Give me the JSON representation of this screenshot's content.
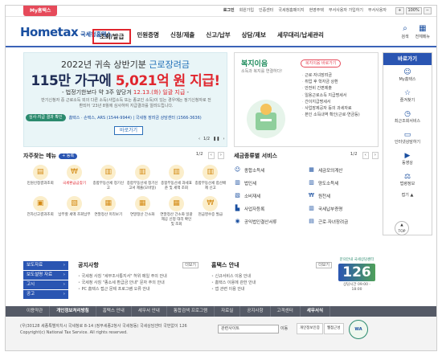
{
  "topbar": {
    "my_tab": "My홈택스",
    "utils": [
      "로그인",
      "회원가입",
      "인증센터",
      "국세청홈페이지",
      "현영주택",
      "부서사용자 가입하기",
      "부서사용자"
    ],
    "zoom_value": "100%"
  },
  "header": {
    "logo_main": "Hometax",
    "logo_sub": "국세청홈택스",
    "gnb": [
      "조회/발급",
      "민원증명",
      "신청/제출",
      "신고/납부",
      "상담/제보",
      "세무대리/납세관리"
    ],
    "search_label": "검색",
    "allmenu_label": "전체메뉴"
  },
  "banner": {
    "line1_a": "2022년 귀속 상반기분",
    "line1_b": "근로장려금",
    "line2_a": "115만 가구에",
    "line2_b": "5,021억 원 지급!",
    "line3_a": "- 법정기한보다 약 3주 앞당겨",
    "line3_b": "12.13.(화) 일괄 지급",
    "line3_c": "-",
    "desc": "반기신청자 중 근로소득 외의 다른 소득(사업소득 또는 종교인 소득)이 있는 경우에는 정기신청자로 전환되어 '23년 8월에 심사하여 지급결과를 알려드립니다.",
    "pill": "심사·지급 결과 확인",
    "strip_text": "홈택스 · 손택스, ARS (1544-9944) | 국세청 장려금 상담센터 (1566-3636)",
    "more_label": "바로가기",
    "counter": "1/2"
  },
  "welfare": {
    "title": "복지이음",
    "subtitle": "소득과 복지를 연결하다!",
    "shortcut": "복지이음 바로가기",
    "items": [
      "근로·자녀장려금",
      "취업 후 학자금 상환",
      "안전비 간편제출",
      "일용근로소득 지급명세서",
      "간이지급명세서",
      "사업장제공자 등의 과세자료",
      "본인 소득내역 확인(근로·연금등)"
    ]
  },
  "quick": {
    "header": "바로가기",
    "items": [
      {
        "icon": "person-icon",
        "label": "My홈택스"
      },
      {
        "icon": "star-icon",
        "label": "즐겨찾기"
      },
      {
        "icon": "clock-icon",
        "label": "최근조회서비스"
      },
      {
        "icon": "monitor-icon",
        "label": "인터넷상담하기"
      },
      {
        "icon": "video-icon",
        "label": "동영상"
      },
      {
        "icon": "gavel-icon",
        "label": "법령정보"
      }
    ],
    "fold_label": "접기 ▲",
    "top_label": "TOP"
  },
  "favorites": {
    "title": "자주찾는 메뉴",
    "register": "+ 등록",
    "counter": "1/2",
    "items": [
      {
        "icon": "card-icon",
        "label": "민원신청결과조회",
        "color": ""
      },
      {
        "icon": "refund-icon",
        "label": "국세환급금찾기",
        "color": "red"
      },
      {
        "icon": "doc-icon",
        "label": "종합부동산세 정기신고",
        "color": ""
      },
      {
        "icon": "doc-icon",
        "label": "종합부동산세 정기신고서 제출(모바일)",
        "color": ""
      },
      {
        "icon": "doc-icon",
        "label": "종합부동산세 과세표준 및 세액 조회",
        "color": ""
      },
      {
        "icon": "doc-icon",
        "label": "종합부동산세 합산배제 신고",
        "color": ""
      },
      {
        "icon": "folder-icon",
        "label": "전자신고결과조회",
        "color": ""
      },
      {
        "icon": "receipt-icon",
        "label": "납부할 세액 조회납부",
        "color": ""
      },
      {
        "icon": "calc-icon",
        "label": "연말정산 미리보기",
        "color": ""
      },
      {
        "icon": "calc-icon",
        "label": "연말정산 간소화",
        "color": ""
      },
      {
        "icon": "calc-icon",
        "label": "연말정산 간소화 일괄제공 신청 대리 확인 및 조회",
        "color": ""
      },
      {
        "icon": "refund-icon",
        "label": "현금영수증 발급",
        "color": ""
      }
    ]
  },
  "tax_forms": {
    "title": "세금종류별 서비스",
    "counter": "1/2",
    "items": [
      {
        "icon": "person-icon",
        "label": "종합소득세"
      },
      {
        "icon": "calc-icon",
        "label": "세금모의계산"
      },
      {
        "icon": "doc-icon",
        "label": "법인세"
      },
      {
        "icon": "doc-icon",
        "label": "양도소득세"
      },
      {
        "icon": "receipt-icon",
        "label": "소비재세"
      },
      {
        "icon": "money-icon",
        "label": "원천세"
      },
      {
        "icon": "building-icon",
        "label": "사업자등록"
      },
      {
        "icon": "doc-icon",
        "label": "국세납부증명"
      },
      {
        "icon": "stamp-icon",
        "label": "공익법인결산서류"
      },
      {
        "icon": "card-icon",
        "label": "근로·자녀장려금"
      }
    ]
  },
  "left_nav": [
    "보도자료",
    "보도설명 자료",
    "고시",
    "공고"
  ],
  "notice": {
    "title": "공지사항",
    "more": "더보기",
    "items": [
      "국세청 사칭 \"세무조사통지서\" 허위 메일 주의 안내",
      "국세청 사칭 \"종소세 환급금 안내\" 문자 주의 안내",
      "PC 홈택스 접근 문제 프로그램 오류 안내"
    ]
  },
  "hometax_notice": {
    "title": "홈택스 안내",
    "more": "더보기",
    "items": [
      "신규서비스 이용 안내",
      "홈택스 이용에 관한 안내",
      "앱 관련 이용 안내"
    ]
  },
  "callcenter": {
    "caption": "문의안내 국세상담센터",
    "number": "126",
    "hours": "상담시간 09:00 - 18:00"
  },
  "footer_nav": [
    "이용약관",
    "개인정보처리방침",
    "홈택스 안내",
    "세무서 안내",
    "통합검색 프로그램",
    "자료실",
    "공지사항",
    "고객센터",
    "세무서식"
  ],
  "footer": {
    "address": "(우)30128 세종특별자치시 국세청로 8-14 (정부세종2청사 국세청동) 국세상담센터 국번없이 126",
    "copyright": "Copyright(c) National Tax Service. All rights reserved.",
    "site_select": "관련사이트",
    "go_label": "이동",
    "badge1": "개인정보인증",
    "badge2": "웹접근성",
    "wa_mark": "WA"
  }
}
